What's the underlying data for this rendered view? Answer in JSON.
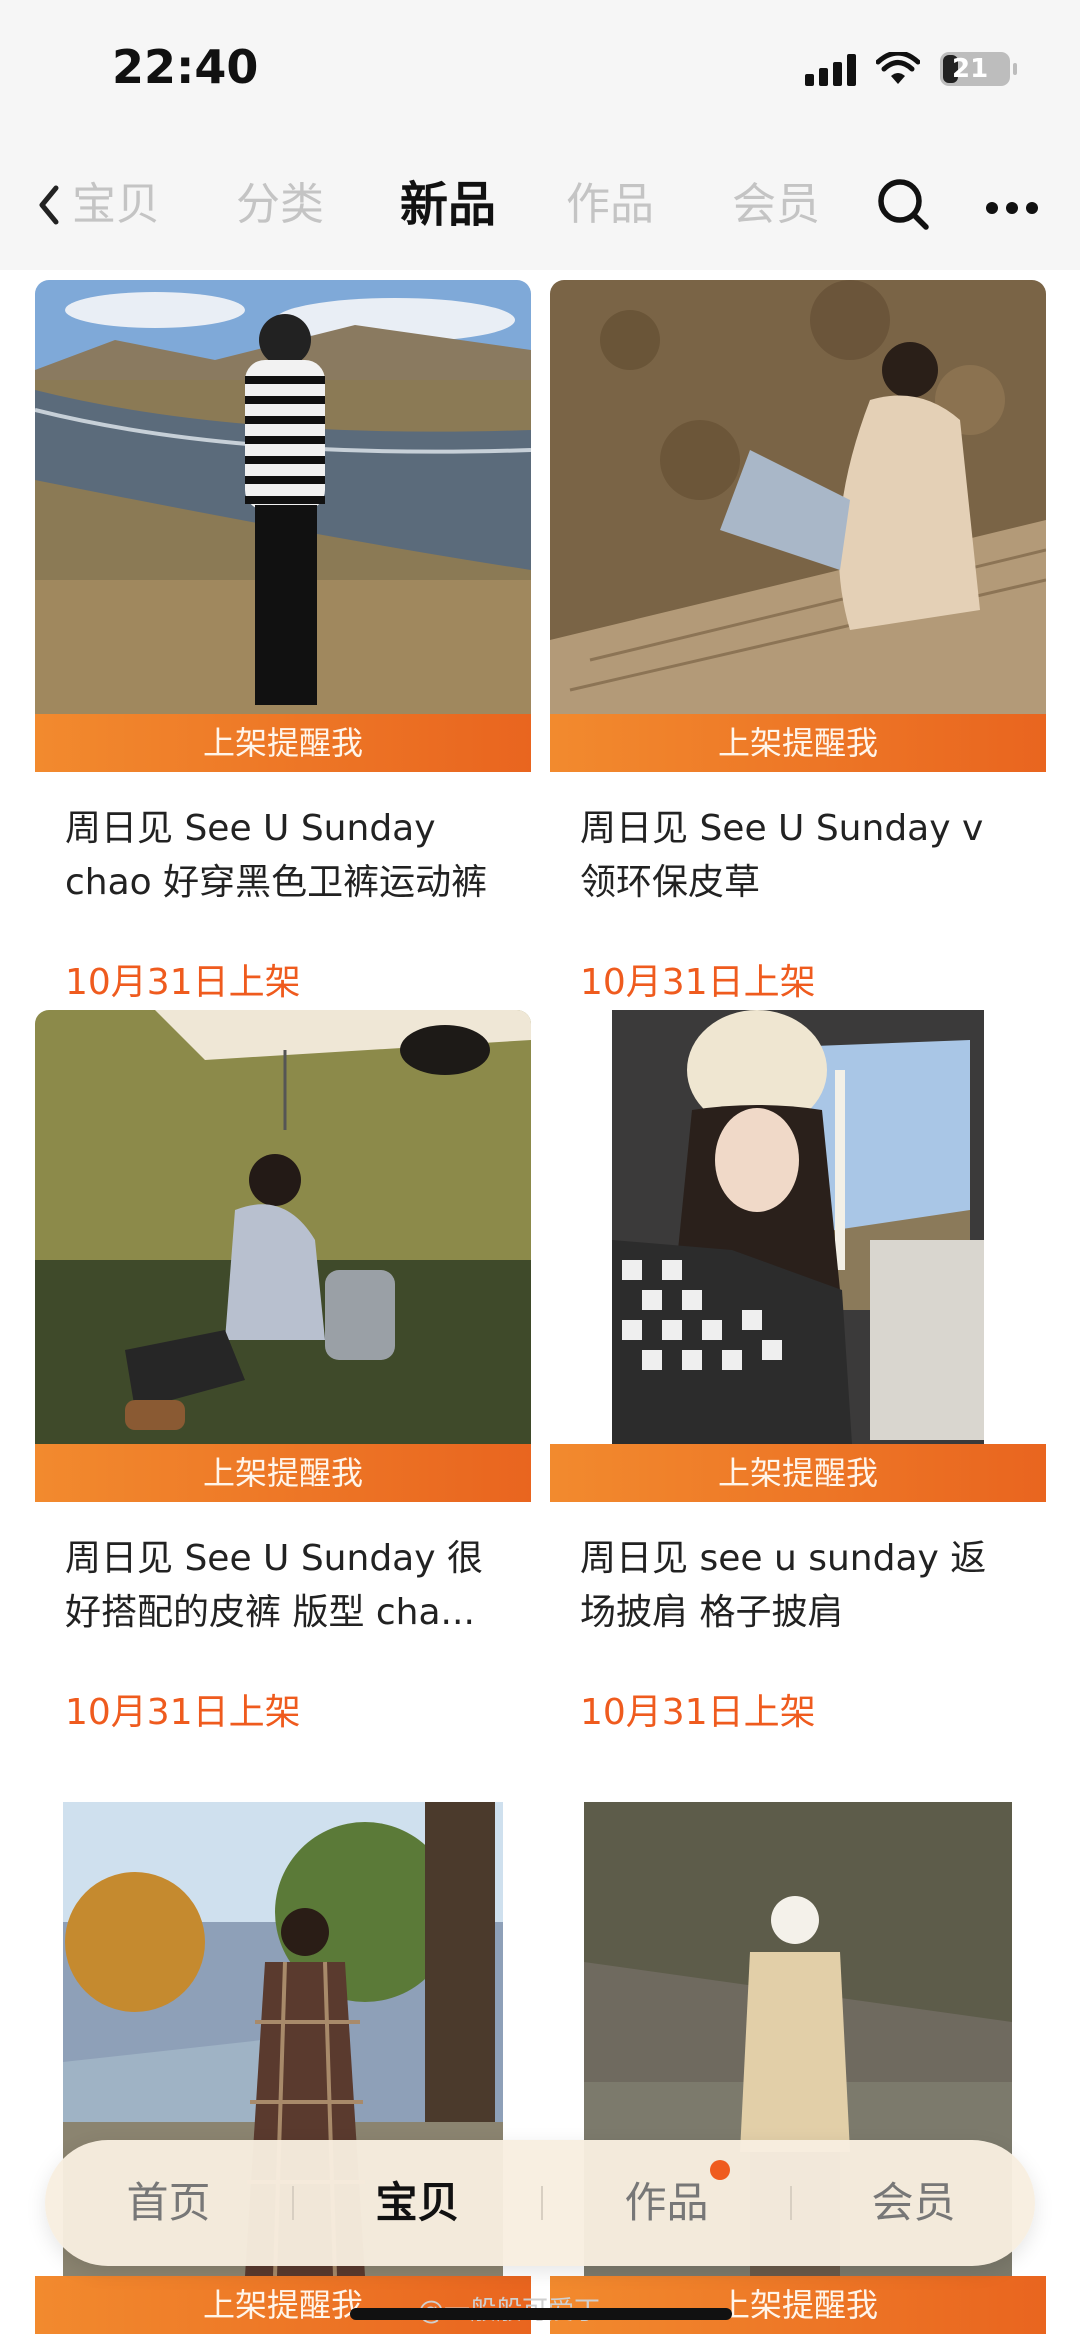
{
  "status_bar": {
    "time": "22:40",
    "battery": "21"
  },
  "nav": {
    "tabs": [
      "宝贝",
      "分类",
      "新品",
      "作品",
      "会员"
    ],
    "active_tab": "新品"
  },
  "products": [
    {
      "banner": "上架提醒我",
      "title": "周日见 See U Sunday chao 好穿黑色卫裤运动裤",
      "date": "10月31日上架"
    },
    {
      "banner": "上架提醒我",
      "title": "周日见 See U Sunday v领环保皮草",
      "date": "10月31日上架"
    },
    {
      "banner": "上架提醒我",
      "title": "周日见 See U Sunday 很好搭配的皮裤  版型 cha...",
      "date": "10月31日上架"
    },
    {
      "banner": "上架提醒我",
      "title": "周日见 see u sunday 返场披肩 格子披肩",
      "date": "10月31日上架"
    },
    {
      "banner": "上架提醒我"
    },
    {
      "banner": "上架提醒我"
    }
  ],
  "bottom_nav": {
    "items": [
      "首页",
      "宝贝",
      "作品",
      "会员"
    ],
    "active": "宝贝"
  },
  "watermark": "@一般般可爱丁",
  "colors": {
    "accent": "#ef5b1e",
    "banner": "#f07a28"
  }
}
